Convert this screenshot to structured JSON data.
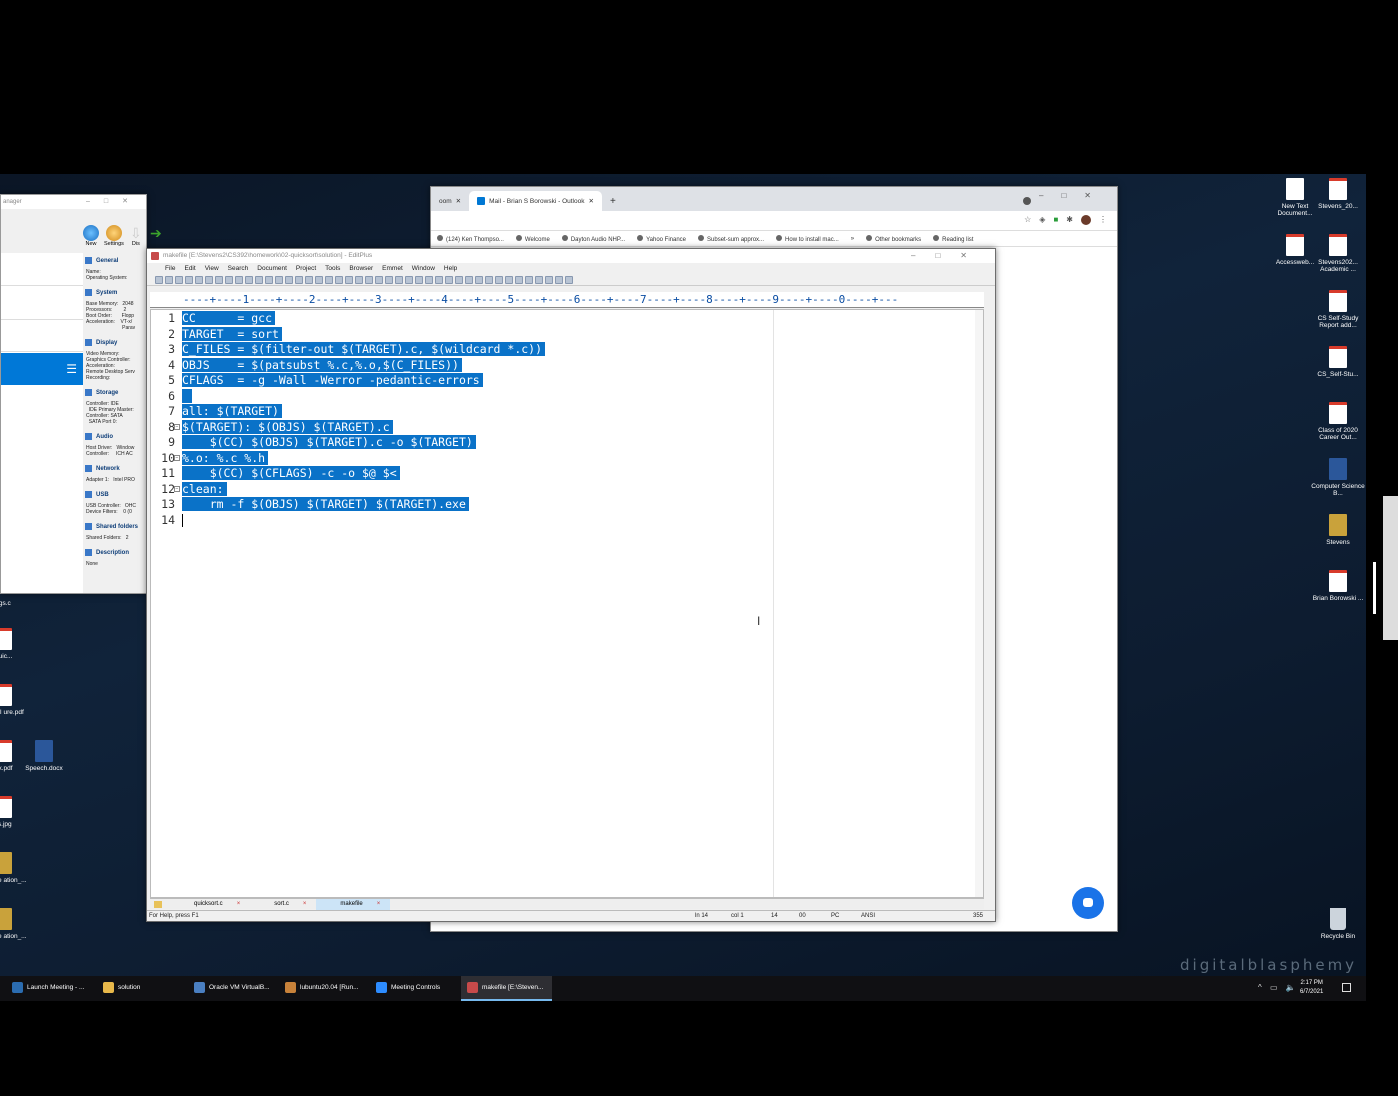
{
  "desktop_icons_right": [
    {
      "label": "New Text Document...",
      "kind": "txt"
    },
    {
      "label": "Stevens_20...",
      "kind": "pdf"
    },
    {
      "label": "Accessweb...",
      "kind": "pdf"
    },
    {
      "label": "Stevens202... Academic ...",
      "kind": "pdf"
    },
    {
      "label": "CS Self-Study Report add...",
      "kind": "pdf"
    },
    {
      "label": "CS_Self-Stu...",
      "kind": "pdf"
    },
    {
      "label": "Class of 2020 Career Out...",
      "kind": "pdf"
    },
    {
      "label": "Computer Science B...",
      "kind": "word"
    },
    {
      "label": "Stevens",
      "kind": "zip"
    },
    {
      "label": "Brian Borowski ...",
      "kind": "pdf"
    },
    {
      "label": "Recycle Bin",
      "kind": "bin"
    }
  ],
  "desktop_icons_left": [
    {
      "label": "ngs.c"
    },
    {
      "label": "Quic..."
    },
    {
      "label": "eries II ure.pdf"
    },
    {
      "label": "aix.pdf"
    },
    {
      "label": "Speech.docx"
    },
    {
      "label": "us.jpg"
    },
    {
      "label": "e Office ation_..."
    },
    {
      "label": "e Office ation_..."
    }
  ],
  "chrome": {
    "tabs": [
      {
        "label": "oom",
        "active": false
      },
      {
        "label": "Mail - Brian S Borowski - Outlook",
        "active": true
      }
    ],
    "bookmarks": [
      "(124) Ken Thompso...",
      "Welcome",
      "Dayton Audio NHP...",
      "Yahoo Finance",
      "Subset-sum approx...",
      "How to install mac...",
      "»",
      "Other bookmarks",
      "Reading list"
    ]
  },
  "vbox": {
    "title": "anager",
    "toolbar": [
      "New",
      "Settings",
      "Dis"
    ],
    "sections": [
      {
        "name": "General",
        "lines": "Name:\nOperating System:"
      },
      {
        "name": "System",
        "lines": "Base Memory:   2048\nProcessors:        2\nBoot Order:       Flopp\nAcceleration:    VT-x/\n                          Parav"
      },
      {
        "name": "Display",
        "lines": "Video Memory:\nGraphics Controller:\nAcceleration:\nRemote Desktop Serv\nRecording:"
      },
      {
        "name": "Storage",
        "lines": "Controller: IDE\n  IDE Primary Master:\nController: SATA\n  SATA Port 0:"
      },
      {
        "name": "Audio",
        "lines": "Host Driver:   Window\nController:     ICH AC"
      },
      {
        "name": "Network",
        "lines": "Adapter 1:   Intel PRO"
      },
      {
        "name": "USB",
        "lines": "USB Controller:   OHC\nDevice Filters:    0 (0"
      },
      {
        "name": "Shared folders",
        "lines": "Shared Folders:   2"
      },
      {
        "name": "Description",
        "lines": "None"
      }
    ]
  },
  "editplus": {
    "title": "makefile [E:\\Stevens2\\CS392\\homework\\02-quicksort\\solution] - EditPlus",
    "menu": [
      "File",
      "Edit",
      "View",
      "Search",
      "Document",
      "Project",
      "Tools",
      "Browser",
      "Emmet",
      "Window",
      "Help"
    ],
    "ruler": "----+----1----+----2----+----3----+----4----+----5----+----6----+----7----+----8----+----9----+----0----+---",
    "lines": [
      "CC      = gcc",
      "TARGET  = sort",
      "C_FILES = $(filter-out $(TARGET).c, $(wildcard *.c))",
      "OBJS    = $(patsubst %.c,%.o,$(C_FILES))",
      "CFLAGS  = -g -Wall -Werror -pedantic-errors",
      " ",
      "all: $(TARGET)",
      "$(TARGET): $(OBJS) $(TARGET).c",
      "    $(CC) $(OBJS) $(TARGET).c -o $(TARGET)",
      "%.o: %.c %.h",
      "    $(CC) $(CFLAGS) -c -o $@ $<",
      "clean:",
      "    rm -f $(OBJS) $(TARGET) $(TARGET).exe",
      ""
    ],
    "line_numbers": [
      "1",
      "2",
      "3",
      "4",
      "5",
      "6",
      "7",
      "8",
      "9",
      "10",
      "11",
      "12",
      "13",
      "14"
    ],
    "file_tabs": [
      {
        "label": "quicksort.c",
        "active": false
      },
      {
        "label": "sort.c",
        "active": false
      },
      {
        "label": "makefile",
        "active": true
      }
    ],
    "status": {
      "help": "For Help, press F1",
      "ln": "ln 14",
      "col": "col 1",
      "sel_lines": "14",
      "sel_extra": "00",
      "format": "PC",
      "encoding": "ANSI",
      "size": "355"
    }
  },
  "taskbar": {
    "items": [
      {
        "label": "Launch Meeting - ...",
        "active": false,
        "color": "#2b6cb0"
      },
      {
        "label": "solution",
        "active": false,
        "color": "#e8b84a"
      },
      {
        "label": "Oracle VM VirtualB...",
        "active": false,
        "color": "#4a7fc1"
      },
      {
        "label": "lubuntu20.04 [Run...",
        "active": false,
        "color": "#c8823a"
      },
      {
        "label": "Meeting Controls",
        "active": false,
        "color": "#2d8cff"
      },
      {
        "label": "makefile [E:\\Steven...",
        "active": true,
        "color": "#c74a4a"
      }
    ],
    "time": "2:17 PM",
    "date": "6/7/2021"
  },
  "watermark": "digitalblasphemy"
}
